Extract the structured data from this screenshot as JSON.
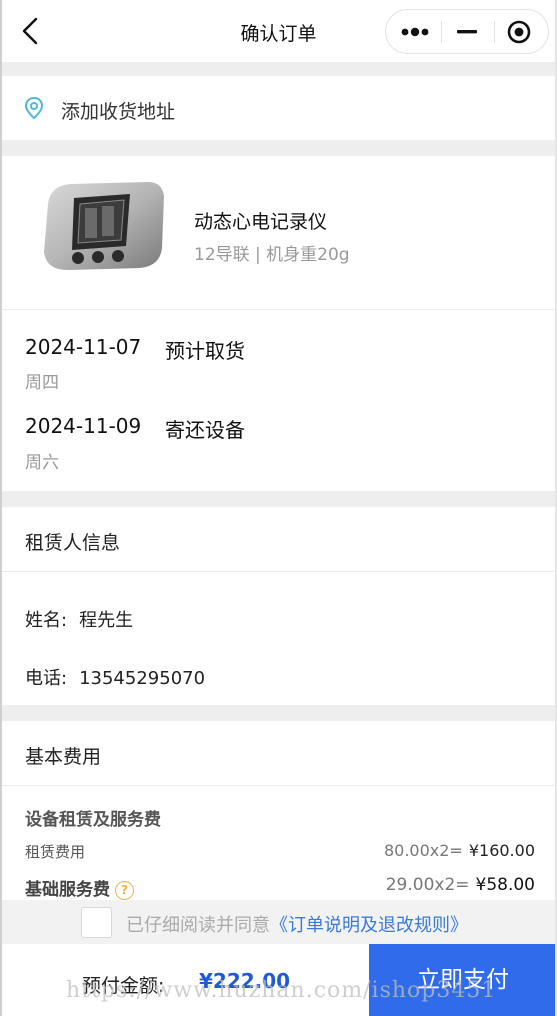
{
  "navbar": {
    "title": "确认订单"
  },
  "address": {
    "label": "添加收货地址"
  },
  "product": {
    "name": "动态心电记录仪",
    "spec": "12导联 | 机身重20g"
  },
  "schedule": [
    {
      "date": "2024-11-07",
      "label": "预计取货",
      "weekday": "周四"
    },
    {
      "date": "2024-11-09",
      "label": "寄还设备",
      "weekday": "周六"
    }
  ],
  "renter": {
    "title": "租赁人信息",
    "name_label": "姓名:",
    "name": "程先生",
    "phone_label": "电话:",
    "phone": "13545295070"
  },
  "fees": {
    "title": "基本费用",
    "group_title": "设备租赁及服务费",
    "rows": [
      {
        "name": "租赁费用",
        "formula": "80.00x2=",
        "price": "¥160.00"
      },
      {
        "name": "基础服务费",
        "formula": "29.00x2=",
        "price": "¥58.00"
      }
    ],
    "help_icon": "question-circle-icon"
  },
  "agreement": {
    "text": "已仔细阅读并同意",
    "link": "《订单说明及退改规则》"
  },
  "footer": {
    "total_label": "预付金额:",
    "total_value": "¥222.00",
    "pay_label": "立即支付"
  },
  "watermark": "https://www.huzhan.com/ishop3451",
  "colors": {
    "accent": "#2f6bea",
    "price_blue": "#1e5cd6",
    "link": "#3a7bd5",
    "pin": "#4fb8d6",
    "help": "#f0b24a"
  }
}
